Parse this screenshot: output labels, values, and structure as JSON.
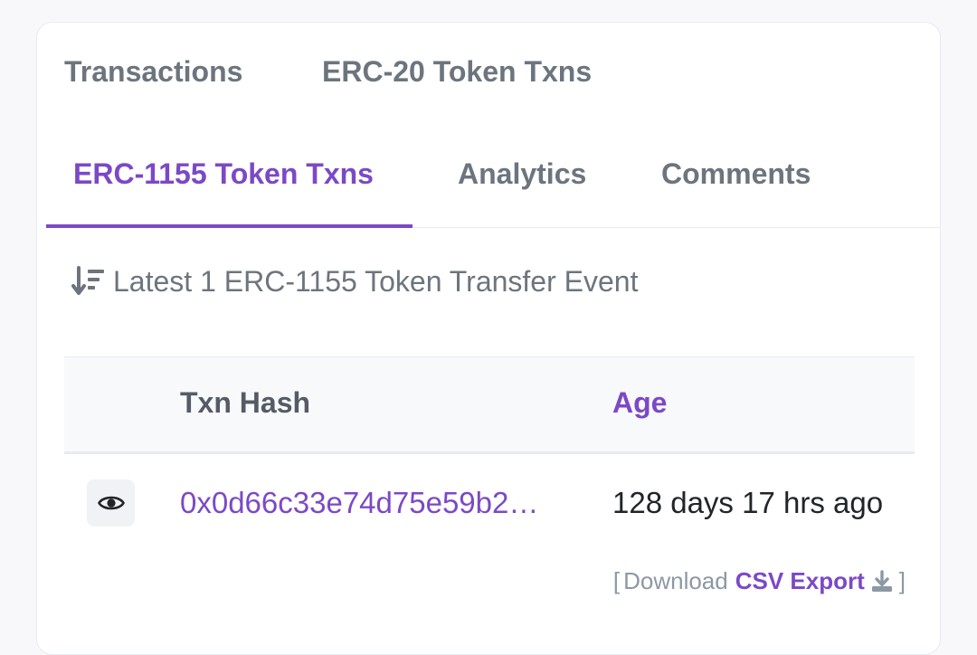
{
  "tabs": [
    {
      "label": "Transactions"
    },
    {
      "label": "ERC-20 Token Txns"
    },
    {
      "label": "ERC-1155 Token Txns"
    },
    {
      "label": "Analytics"
    },
    {
      "label": "Comments"
    }
  ],
  "active_tab": "ERC-1155 Token Txns",
  "summary": {
    "text": "Latest 1 ERC-1155 Token Transfer Event",
    "icon": "sort-descending-icon"
  },
  "table": {
    "columns": [
      "Txn Hash",
      "Age"
    ],
    "rows": [
      {
        "txn_hash": "0x0d66c33e74d75e59b2…",
        "age": "128 days 17 hrs ago"
      }
    ]
  },
  "footer": {
    "open_bracket": "[",
    "prefix": "Download",
    "link": "CSV Export",
    "close_bracket": "]",
    "icon": "download-icon"
  },
  "colors": {
    "accent": "#7b49c6",
    "muted": "#6c757d"
  }
}
